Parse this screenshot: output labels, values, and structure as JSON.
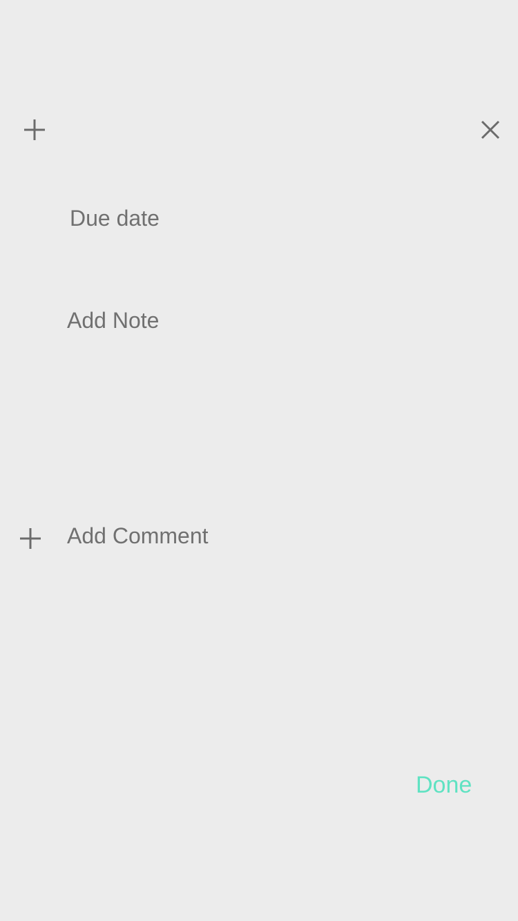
{
  "header": {
    "add_icon": "plus-icon",
    "close_icon": "close-icon"
  },
  "task": {
    "due_date_placeholder": "Due date",
    "note_placeholder": "Add Note"
  },
  "comments": {
    "add_icon": "plus-icon",
    "placeholder": "Add Comment"
  },
  "footer": {
    "done_label": "Done"
  },
  "colors": {
    "background": "#ececec",
    "text": "#707070",
    "accent": "#5fe2c2"
  }
}
